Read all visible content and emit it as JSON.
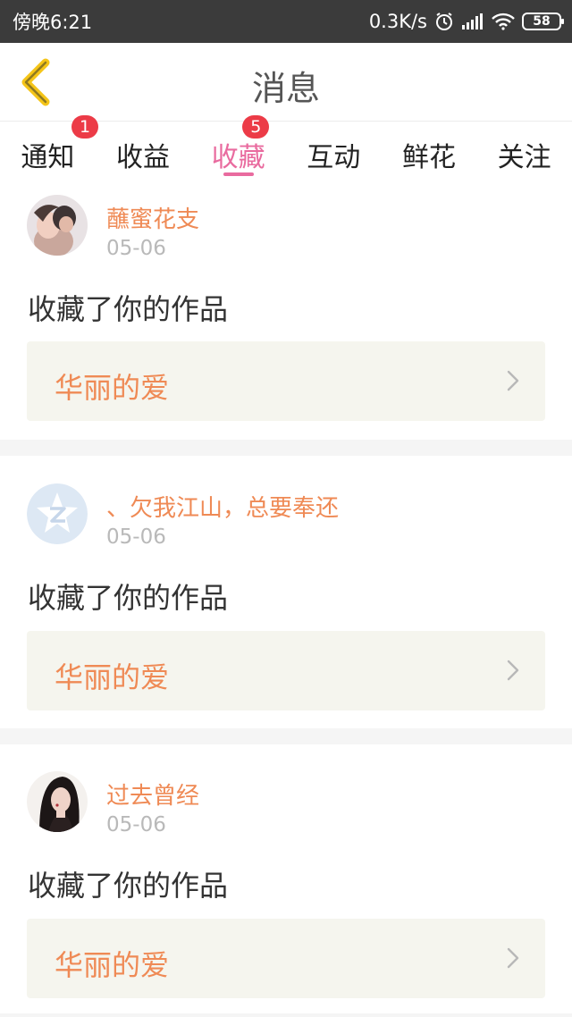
{
  "status_bar": {
    "time": "傍晚6:21",
    "speed": "0.3K/s",
    "battery": "58",
    "icons": [
      "alarm-icon",
      "signal-icon",
      "wifi-icon",
      "battery-icon"
    ]
  },
  "header": {
    "title": "消息",
    "back_icon": "chevron-left-icon",
    "accent_color": "#f5c518"
  },
  "tabs": [
    {
      "label": "通知",
      "badge": "1"
    },
    {
      "label": "收益",
      "badge": ""
    },
    {
      "label": "收藏",
      "badge": "5",
      "active": true
    },
    {
      "label": "互动",
      "badge": ""
    },
    {
      "label": "鲜花",
      "badge": ""
    },
    {
      "label": "关注",
      "badge": ""
    }
  ],
  "messages": [
    {
      "user": "蘸蜜花支",
      "date": "05-06",
      "text": "收藏了你的作品",
      "work": "华丽的爱"
    },
    {
      "user": "、欠我江山，总要奉还",
      "date": "05-06",
      "text": "收藏了你的作品",
      "work": "华丽的爱"
    },
    {
      "user": "过去曾经",
      "date": "05-06",
      "text": "收藏了你的作品",
      "work": "华丽的爱"
    }
  ],
  "colors": {
    "active_tab": "#e96b9f",
    "badge": "#ec3b47",
    "username": "#ef8a55",
    "work_bg": "#f5f5ee"
  }
}
